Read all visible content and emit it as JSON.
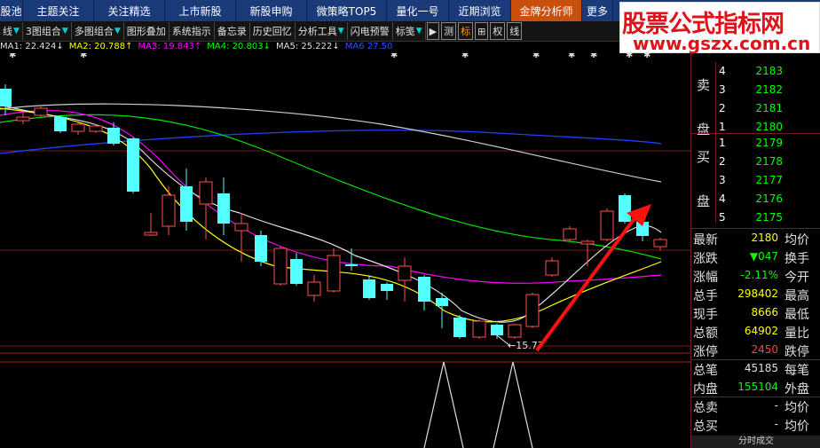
{
  "nav_tabs": [
    {
      "label": "股池",
      "active": false
    },
    {
      "label": "主题关注",
      "active": false
    },
    {
      "label": "关注精选",
      "active": false
    },
    {
      "label": "上市新股",
      "active": false
    },
    {
      "label": "新股申购",
      "active": false
    },
    {
      "label": "微策略TOP5",
      "active": false
    },
    {
      "label": "量化一号",
      "active": false
    },
    {
      "label": "近期浏览",
      "active": false
    },
    {
      "label": "金牌分析师",
      "active": true
    },
    {
      "label": "更多",
      "active": false
    }
  ],
  "toolbar": [
    {
      "label": "线",
      "arrow": true
    },
    {
      "label": "3图组合",
      "arrow": true
    },
    {
      "label": "多图组合",
      "arrow": true
    },
    {
      "label": "图形叠加",
      "arrow": false
    },
    {
      "label": "系统指示",
      "arrow": false
    },
    {
      "label": "备忘录",
      "arrow": false
    },
    {
      "label": "历史回忆",
      "arrow": false
    },
    {
      "label": "分析工具",
      "arrow": true
    },
    {
      "label": "闪电预警",
      "arrow": false
    },
    {
      "label": "标笺",
      "arrow": true
    },
    {
      "label": "▶",
      "arrow": false
    },
    {
      "label": "测",
      "arrow": false
    },
    {
      "label": "标",
      "arrow": false
    },
    {
      "label": "⊞",
      "arrow": false
    },
    {
      "label": "权",
      "arrow": false
    },
    {
      "label": "线",
      "arrow": false
    }
  ],
  "ma_legend": [
    {
      "text": "MA1: 22.424↓",
      "color": "#e0e0e0"
    },
    {
      "text": "MA2: 20.788↑",
      "color": "#ffff00"
    },
    {
      "text": "MA3: 19.843↑",
      "color": "#ff00ff"
    },
    {
      "text": "MA4: 20.803↓",
      "color": "#00ff00"
    },
    {
      "text": "MA5: 25.222↓",
      "color": "#e0e0e0"
    },
    {
      "text": "MA6  27.50",
      "color": "#3050ff"
    }
  ],
  "watermark": {
    "line1": "股票公式指标网",
    "line2": "www.gszx.com.cn"
  },
  "chart_labels": {
    "low_label": "←15.77"
  },
  "order_book": {
    "sell_side_label": [
      "卖",
      "盘"
    ],
    "buy_side_label": [
      "买",
      "盘"
    ],
    "sells": [
      {
        "level": "4",
        "price": "2183",
        "qty": "23"
      },
      {
        "level": "3",
        "price": "2182",
        "qty": "16"
      },
      {
        "level": "2",
        "price": "2181",
        "qty": "10"
      },
      {
        "level": "1",
        "price": "2180",
        "qty": "70"
      }
    ],
    "buys": [
      {
        "level": "1",
        "price": "2179",
        "qty": "68"
      },
      {
        "level": "2",
        "price": "2178",
        "qty": "184"
      },
      {
        "level": "3",
        "price": "2177",
        "qty": "467"
      },
      {
        "level": "4",
        "price": "2176",
        "qty": "27"
      },
      {
        "level": "5",
        "price": "2175",
        "qty": "31"
      }
    ]
  },
  "stats": [
    {
      "left": "最新",
      "value": "2180",
      "value_color": "#ffff00",
      "right": "均价"
    },
    {
      "left": "涨跌",
      "value": "▼047",
      "value_color": "#00ff00",
      "right": "换手"
    },
    {
      "left": "涨幅",
      "value": "-2.11%",
      "value_color": "#00ff00",
      "right": "今开"
    },
    {
      "left": "总手",
      "value": "298402",
      "value_color": "#ffff00",
      "right": "最高"
    },
    {
      "left": "现手",
      "value": "8666",
      "value_color": "#ffff00",
      "right": "最低"
    },
    {
      "left": "总额",
      "value": "64902",
      "value_color": "#ffff00",
      "right": "量比"
    },
    {
      "left": "涨停",
      "value": "2450",
      "value_color": "#ff4040",
      "right": "跌停"
    },
    {
      "left": "总笔",
      "value": "45185",
      "value_color": "#e0e0e0",
      "right": "每笔"
    },
    {
      "left": "内盘",
      "value": "155104",
      "value_color": "#00ff00",
      "right": "外盘"
    },
    {
      "left": "总卖",
      "value": "-",
      "value_color": "#e0e0e0",
      "right": "均价"
    },
    {
      "left": "总买",
      "value": "-",
      "value_color": "#e0e0e0",
      "right": "均价"
    }
  ],
  "bottom_tab": "分时成交"
}
